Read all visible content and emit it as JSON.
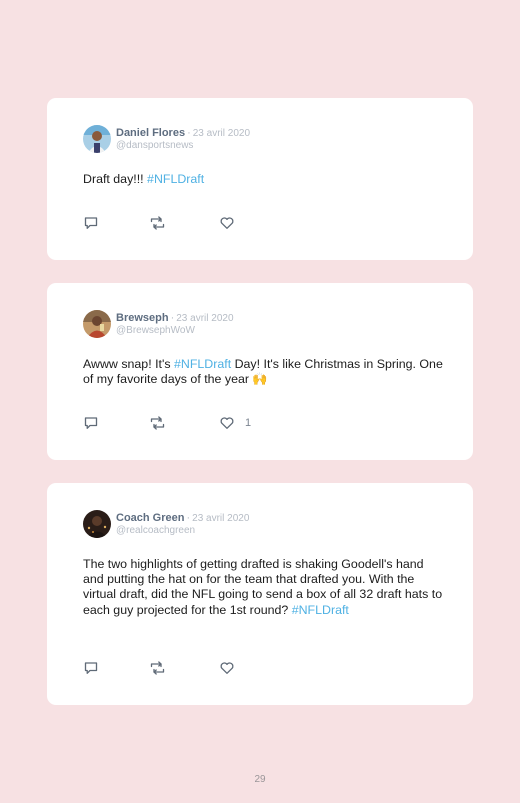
{
  "tweets": [
    {
      "name": "Daniel Flores",
      "separator": "·",
      "date": "23 avril 2020",
      "handle": "@dansportsnews",
      "text_plain": "Draft day!!! ",
      "hashtag": "#NFLDraft",
      "likes": "",
      "avatar_icon": "avatar-photo"
    },
    {
      "name": "Brewseph",
      "separator": "·",
      "date": "23 avril 2020",
      "handle": "@BrewsephWoW",
      "text_before": "Awww snap! It's ",
      "hashtag": "#NFLDraft",
      "text_after": " Day! It's like Christmas in Spring. One of my favorite days of the year 🙌",
      "likes": "1",
      "avatar_icon": "avatar-photo"
    },
    {
      "name": "Coach Green",
      "separator": "·",
      "date": "23 avril 2020",
      "handle": "@realcoachgreen",
      "text_plain": "The two highlights of getting drafted is shaking Goodell's hand and putting the hat on for the team that drafted you. With the virtual draft, did the NFL going to send a box of all 32 draft hats to each guy projected for the 1st round? ",
      "hashtag": "#NFLDraft",
      "likes": "",
      "avatar_icon": "avatar-photo"
    }
  ],
  "icons": {
    "reply": "reply-icon",
    "retweet": "retweet-icon",
    "like": "heart-icon"
  },
  "colors": {
    "background": "#f7e1e3",
    "card": "#ffffff",
    "hashtag": "#4fb1e3",
    "name": "#5e6d80",
    "muted": "#b6bcc5"
  },
  "page_number": "29"
}
